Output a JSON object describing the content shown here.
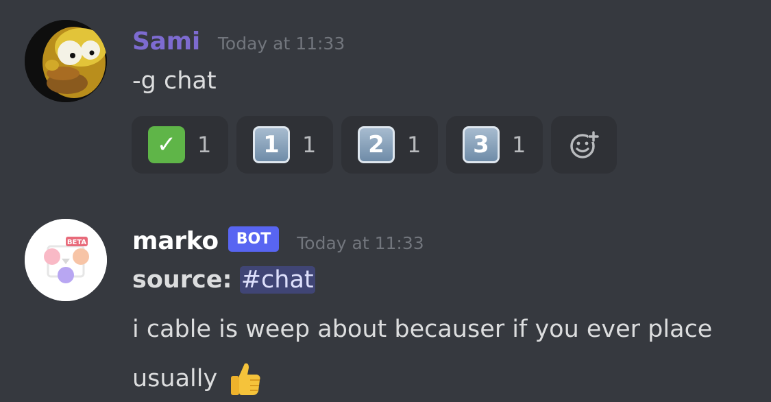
{
  "messages": [
    {
      "author": "Sami",
      "author_color": "#7d6bd0",
      "timestamp": "Today at 11:33",
      "content": "-g chat",
      "avatar": "homer-simpson-avatar",
      "reactions": [
        {
          "emoji": "✓",
          "emoji_name": "white-check-mark",
          "count": "1"
        },
        {
          "emoji": "1",
          "emoji_name": "keycap-one",
          "count": "1"
        },
        {
          "emoji": "2",
          "emoji_name": "keycap-two",
          "count": "1"
        },
        {
          "emoji": "3",
          "emoji_name": "keycap-three",
          "count": "1"
        }
      ],
      "add_reaction_icon": "add-reaction-icon"
    },
    {
      "author": "marko",
      "author_color": "#ffffff",
      "bot_tag": "BOT",
      "timestamp": "Today at 11:33",
      "source_label": "source:",
      "source_channel": "#chat",
      "content_line1": "i cable is weep about becauser if you ever place",
      "content_line2": "usually",
      "emoji": "thumbs-up",
      "avatar": "beta-bot-avatar",
      "avatar_badge": "BETA"
    }
  ]
}
